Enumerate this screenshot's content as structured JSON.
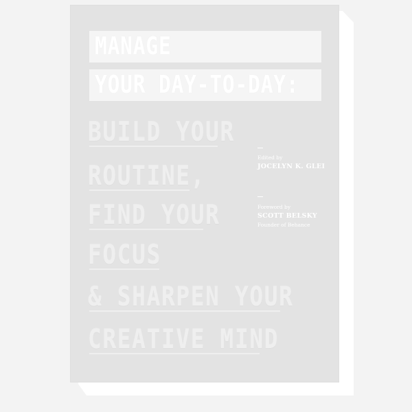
{
  "book": {
    "title_line_1": "MANAGE",
    "title_line_2": "YOUR DAY-TO-DAY:",
    "subtitle_lines": [
      "BUILD YOUR",
      "ROUTINE,",
      "FIND YOUR",
      "FOCUS",
      "& SHARPEN YOUR",
      "CREATIVE MIND"
    ],
    "editor": {
      "role": "Edited by",
      "name": "JOCELYN K. GLEI"
    },
    "foreword": {
      "role": "Foreword by",
      "name": "SCOTT BELSKY",
      "affiliation": "Founder of Behance"
    }
  },
  "colors": {
    "background": "#f3f3f3",
    "cover": "#e3e3e3",
    "title_bar": "#f5f5f5",
    "text": "#ffffff"
  }
}
